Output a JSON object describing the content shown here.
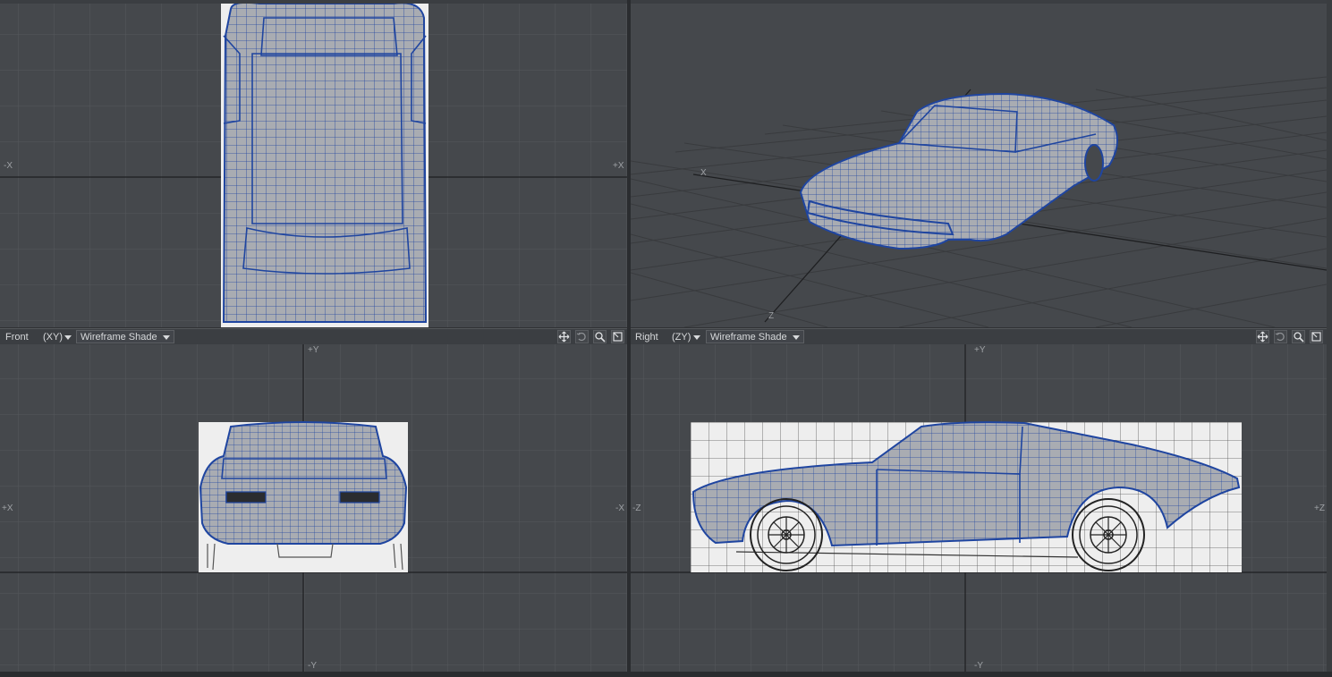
{
  "viewports": {
    "top_left": {
      "axis_left": "-X",
      "axis_right": "+X"
    },
    "top_right": {
      "axis_x": "X",
      "axis_z": "Z"
    },
    "bottom_left": {
      "view_name": "Front",
      "axes": "(XY)",
      "shading": "Wireframe Shade",
      "axis_top": "+Y",
      "axis_bottom": "-Y",
      "axis_left": "+X",
      "axis_right": "-X"
    },
    "bottom_right": {
      "view_name": "Right",
      "axes": "(ZY)",
      "shading": "Wireframe Shade",
      "axis_top": "+Y",
      "axis_bottom": "-Y",
      "axis_left": "-Z",
      "axis_right": "+Z"
    }
  },
  "icons": [
    "move-icon",
    "rotate-icon",
    "zoom-icon",
    "maximize-icon"
  ],
  "colors": {
    "viewport_bg": "#45484c",
    "grid": "#55585c",
    "axis": "#1e1f21",
    "wire": "#1f45a0",
    "surface": "#a9acb2",
    "backdrop": "#eeeeee"
  }
}
